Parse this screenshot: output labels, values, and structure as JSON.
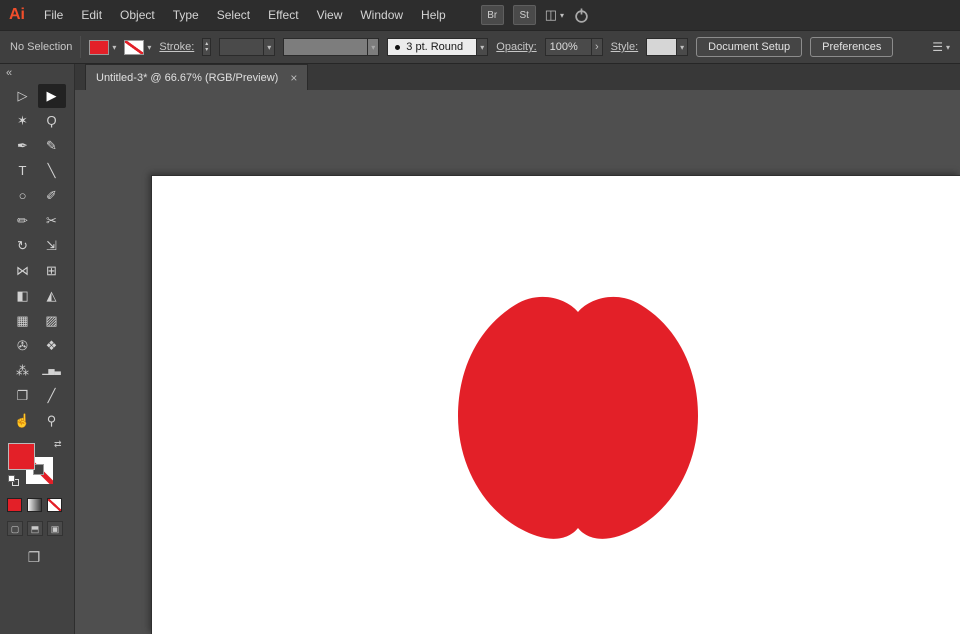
{
  "colors": {
    "accent_red": "#e32028",
    "logo_orange": "#f04e2b"
  },
  "icons": {
    "chevron_down": "▾",
    "stepper_up": "▴",
    "stepper_down": "▾",
    "panel_arrow": "›",
    "menu": "☰",
    "swap": "⇄",
    "close": "×",
    "collapse": "«",
    "workspace": "◫",
    "screen_mode": "❐"
  },
  "menubar": {
    "logo": "Ai",
    "items": [
      "File",
      "Edit",
      "Object",
      "Type",
      "Select",
      "Effect",
      "View",
      "Window",
      "Help"
    ],
    "bridge_button": "Br",
    "stock_button": "St"
  },
  "controlbar": {
    "selection_status": "No Selection",
    "stroke_label": "Stroke:",
    "stroke_weight_value": "",
    "width_profile_value": "",
    "brush_definition": "3 pt. Round",
    "opacity_label": "Opacity:",
    "opacity_value": "100%",
    "style_label": "Style:",
    "document_setup_button": "Document Setup",
    "preferences_button": "Preferences"
  },
  "tabbar": {
    "active_tab_title": "Untitled-3* @ 66.67% (RGB/Preview)"
  },
  "toolbar": {
    "tools": [
      {
        "name": "direct-selection-tool",
        "glyph": "▷"
      },
      {
        "name": "selection-tool",
        "glyph": "▶",
        "active": true
      },
      {
        "name": "magic-wand-tool",
        "glyph": "✶"
      },
      {
        "name": "lasso-tool",
        "glyph": "Ϙ"
      },
      {
        "name": "pen-tool",
        "glyph": "✒"
      },
      {
        "name": "curvature-tool",
        "glyph": "✎"
      },
      {
        "name": "type-tool",
        "glyph": "T"
      },
      {
        "name": "line-segment-tool",
        "glyph": "╲"
      },
      {
        "name": "ellipse-tool",
        "glyph": "○"
      },
      {
        "name": "paintbrush-tool",
        "glyph": "✐"
      },
      {
        "name": "pencil-tool",
        "glyph": "✏"
      },
      {
        "name": "scissors-tool",
        "glyph": "✂"
      },
      {
        "name": "rotate-tool",
        "glyph": "↻"
      },
      {
        "name": "scale-tool",
        "glyph": "⇲"
      },
      {
        "name": "width-tool",
        "glyph": "⋈"
      },
      {
        "name": "free-transform-tool",
        "glyph": "⊞"
      },
      {
        "name": "shape-builder-tool",
        "glyph": "◧"
      },
      {
        "name": "perspective-grid-tool",
        "glyph": "◭"
      },
      {
        "name": "mesh-tool",
        "glyph": "▦"
      },
      {
        "name": "gradient-tool",
        "glyph": "▨"
      },
      {
        "name": "eyedropper-tool",
        "glyph": "✇"
      },
      {
        "name": "blend-tool",
        "glyph": "❖"
      },
      {
        "name": "symbol-sprayer-tool",
        "glyph": "⁂"
      },
      {
        "name": "column-graph-tool",
        "glyph": "▁▅▃"
      },
      {
        "name": "artboard-tool",
        "glyph": "❐"
      },
      {
        "name": "slice-tool",
        "glyph": "╱"
      },
      {
        "name": "hand-tool",
        "glyph": "☝"
      },
      {
        "name": "zoom-tool",
        "glyph": "⚲"
      }
    ],
    "swatch_buttons": [
      {
        "name": "color-swatch-button",
        "type": "color"
      },
      {
        "name": "gradient-swatch-button",
        "type": "gradient"
      },
      {
        "name": "none-swatch-button",
        "type": "none"
      }
    ],
    "draw_modes": [
      {
        "name": "draw-normal-mode-button",
        "glyph": "▢"
      },
      {
        "name": "draw-behind-mode-button",
        "glyph": "⬒"
      },
      {
        "name": "draw-inside-mode-button",
        "glyph": "▣"
      }
    ]
  },
  "canvas": {
    "shape": {
      "name": "apple",
      "fill": "#e32028"
    }
  }
}
